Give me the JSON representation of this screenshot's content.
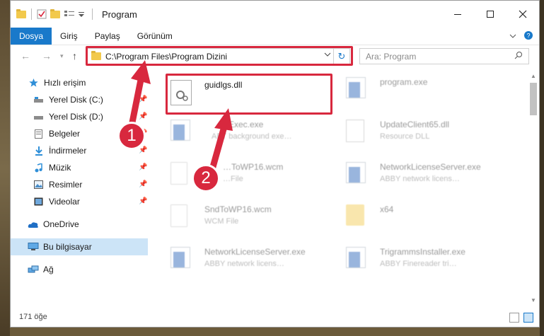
{
  "window": {
    "title": "Program"
  },
  "ribbon": {
    "tabs": [
      "Dosya",
      "Giriş",
      "Paylaş",
      "Görünüm"
    ]
  },
  "address": {
    "path": "C:\\Program Files\\Program Dizini"
  },
  "search": {
    "placeholder": "Ara: Program"
  },
  "sidebar": {
    "items": [
      {
        "label": "Hızlı erişim",
        "icon": "star-icon"
      },
      {
        "label": "Yerel Disk (C:)",
        "icon": "drive-icon"
      },
      {
        "label": "Yerel Disk (D:)",
        "icon": "drive-icon"
      },
      {
        "label": "Belgeler",
        "icon": "documents-icon"
      },
      {
        "label": "İndirmeler",
        "icon": "download-icon"
      },
      {
        "label": "Müzik",
        "icon": "music-icon"
      },
      {
        "label": "Resimler",
        "icon": "pictures-icon"
      },
      {
        "label": "Videolar",
        "icon": "video-icon"
      },
      {
        "label": "OneDrive",
        "icon": "cloud-icon"
      },
      {
        "label": "Bu bilgisayar",
        "icon": "computer-icon"
      },
      {
        "label": "Ağ",
        "icon": "network-icon"
      }
    ]
  },
  "files": [
    {
      "name": "guidlgs.dll",
      "desc": ""
    },
    {
      "name": "program.exe",
      "desc": ""
    },
    {
      "name": "…Exec.exe",
      "desc": "ABT background exe…"
    },
    {
      "name": "UpdateClient65.dll",
      "desc": "Resource DLL"
    },
    {
      "name": "…ToWP16.wcm",
      "desc": "…File"
    },
    {
      "name": "NetworkLicenseServer.exe",
      "desc": "ABBY network licens…"
    },
    {
      "name": "SndToWP16.wcm",
      "desc": "WCM File"
    },
    {
      "name": "x64",
      "desc": ""
    },
    {
      "name": "NetworkLicenseServer.exe",
      "desc": "ABBY network licens…"
    },
    {
      "name": "TrigrammsInstaller.exe",
      "desc": "ABBY Finereader tri…"
    }
  ],
  "status": {
    "count": "171 öğe"
  },
  "annotations": {
    "step1": "1",
    "step2": "2"
  },
  "colors": {
    "accent": "#1979ca",
    "highlight": "#d8283e",
    "arrow": "#d8283e"
  }
}
